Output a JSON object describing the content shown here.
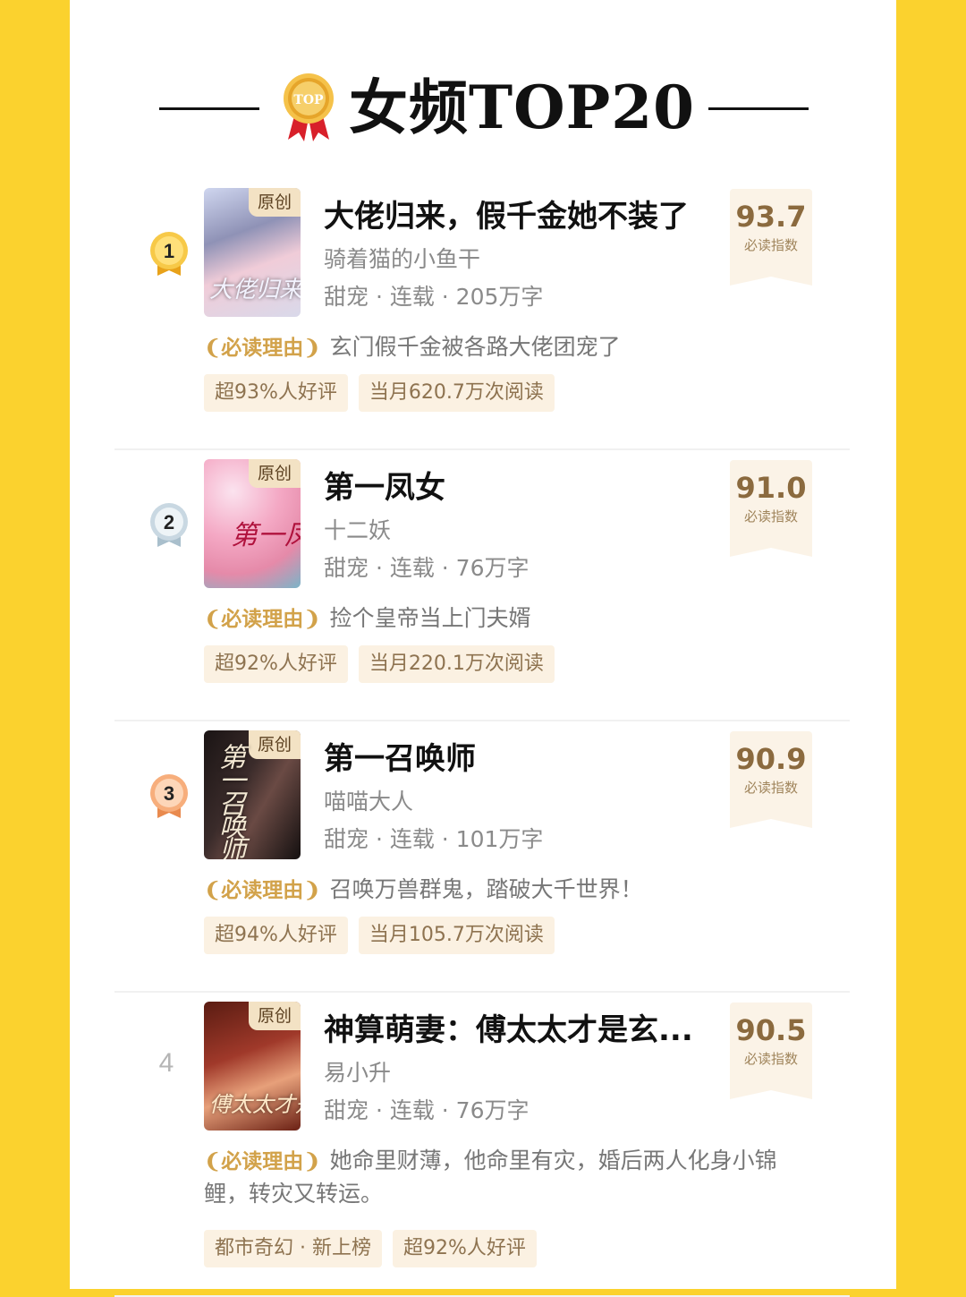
{
  "header": {
    "title": "女频TOP20",
    "medal_icon": "top-medal-icon",
    "medal_text": "TOP"
  },
  "books": [
    {
      "rank": "1",
      "cover_tag": "原创",
      "cover_text": "大佬归来",
      "title": "大佬归来，假千金她不装了",
      "author": "骑着猫的小鱼干",
      "meta": "甜宠 · 连载 · 205万字",
      "score": "93.7",
      "score_label": "必读指数",
      "reason_label": "必读理由",
      "reason": "玄门假千金被各路大佬团宠了",
      "chips": [
        "超93%人好评",
        "当月620.7万次阅读"
      ]
    },
    {
      "rank": "2",
      "cover_tag": "原创",
      "cover_text": "第一凤女",
      "title": "第一凤女",
      "author": "十二妖",
      "meta": "甜宠 · 连载 · 76万字",
      "score": "91.0",
      "score_label": "必读指数",
      "reason_label": "必读理由",
      "reason": "捡个皇帝当上门夫婿",
      "chips": [
        "超92%人好评",
        "当月220.1万次阅读"
      ]
    },
    {
      "rank": "3",
      "cover_tag": "原创",
      "cover_text": "第一召唤师",
      "title": "第一召唤师",
      "author": "喵喵大人",
      "meta": "甜宠 · 连载 · 101万字",
      "score": "90.9",
      "score_label": "必读指数",
      "reason_label": "必读理由",
      "reason": "召唤万兽群鬼，踏破大千世界！",
      "chips": [
        "超94%人好评",
        "当月105.7万次阅读"
      ]
    },
    {
      "rank": "4",
      "cover_tag": "原创",
      "cover_text": "傅太太才是玄学真大佬",
      "title": "神算萌妻：傅太太才是玄...",
      "author": "易小升",
      "meta": "甜宠 · 连载 · 76万字",
      "score": "90.5",
      "score_label": "必读指数",
      "reason_label": "必读理由",
      "reason": "她命里财薄，他命里有灾，婚后两人化身小锦鲤，转灾又转运。",
      "chips": [
        "都市奇幻 · 新上榜",
        "超92%人好评"
      ]
    }
  ],
  "colors": {
    "background": "#FBD22E",
    "panel": "#FFFFFF",
    "score_bg": "#FBF3E7",
    "score_text": "#8B6A3E",
    "chip_bg": "#FBF1E2",
    "gold": "#F2B51E",
    "silver": "#BFD0DA",
    "bronze": "#F4A36E"
  }
}
